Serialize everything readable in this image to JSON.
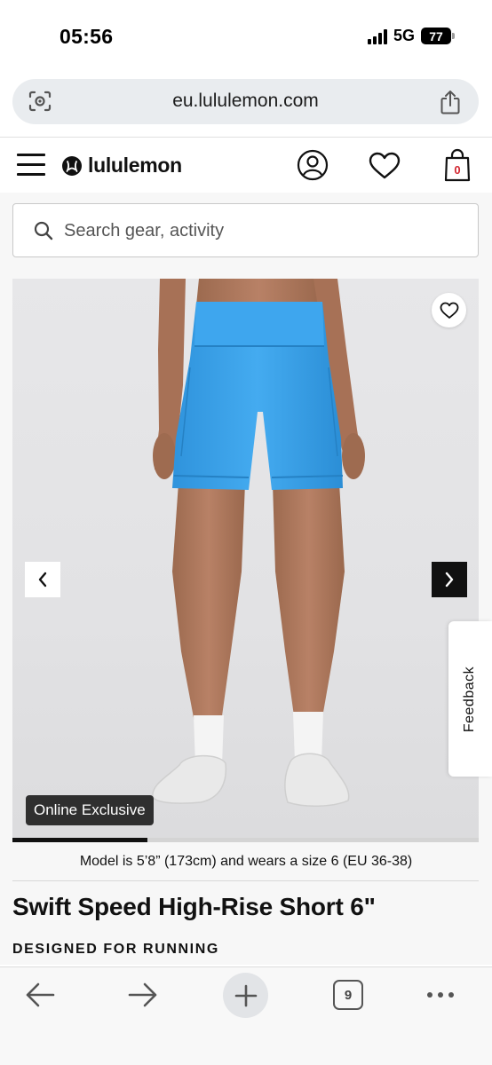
{
  "status_bar": {
    "time": "05:56",
    "network": "5G",
    "battery": "77"
  },
  "browser": {
    "url": "eu.lululemon.com",
    "open_tabs": "9"
  },
  "site": {
    "brand": "lululemon",
    "bag_count": "0",
    "brand_color": "#d22630"
  },
  "search": {
    "placeholder": "Search gear, activity"
  },
  "product": {
    "badge": "Online Exclusive",
    "gallery_progress_fraction": 0.29,
    "model_note": "Model is 5’8” (173cm) and wears a size 6 (EU 36-38)",
    "title": "Swift Speed High-Rise Short 6\"",
    "subtitle": "DESIGNED FOR RUNNING",
    "color_hex": "#3aa2ec"
  },
  "feedback": {
    "label": "Feedback"
  },
  "icons": {
    "menu": "hamburger-icon",
    "account": "account-icon",
    "wishlist": "heart-icon",
    "bag": "shopping-bag-icon",
    "search": "search-icon",
    "share": "share-icon",
    "lens": "lens-icon"
  }
}
